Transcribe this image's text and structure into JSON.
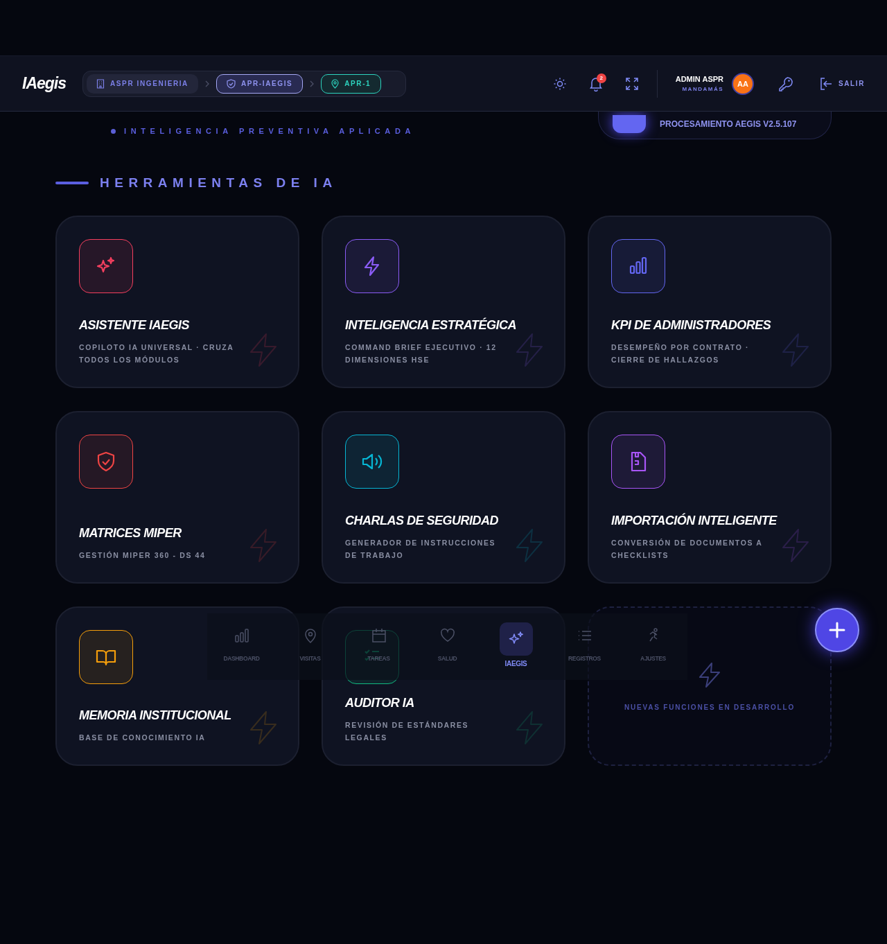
{
  "header": {
    "logo": "IAegis",
    "breadcrumbs": [
      {
        "kind": "company",
        "label": "ASPR INGENIERIA"
      },
      {
        "kind": "project",
        "label": "APR-IAEGIS"
      },
      {
        "kind": "site",
        "label": "APR-1"
      }
    ],
    "notifications": "2",
    "user": {
      "name": "ADMIN ASPR",
      "role": "MANDAMÁS",
      "initials": "AA"
    },
    "logout": "SALIR"
  },
  "status_pill": "PROCESAMIENTO AEGIS V2.5.107",
  "tagline": "INTELIGENCIA PREVENTIVA APLICADA",
  "section_title": "HERRAMIENTAS DE IA",
  "cards": [
    {
      "title": "ASISTENTE IAEGIS",
      "subtitle": "COPILOTO IA UNIVERSAL · CRUZA TODOS LOS MÓDULOS",
      "color": "#f43f5e"
    },
    {
      "title": "INTELIGENCIA ESTRATÉGICA",
      "subtitle": "COMMAND BRIEF EJECUTIVO · 12 DIMENSIONES HSE",
      "color": "#8b5cf6"
    },
    {
      "title": "KPI DE ADMINISTRADORES",
      "subtitle": "DESEMPEÑO POR CONTRATO · CIERRE DE HALLAZGOS",
      "color": "#6366f1"
    },
    {
      "title": "MATRICES MIPER",
      "subtitle": "GESTIÓN MIPER 360 - DS 44",
      "color": "#ef4444"
    },
    {
      "title": "CHARLAS DE SEGURIDAD",
      "subtitle": "GENERADOR DE INSTRUCCIONES DE TRABAJO",
      "color": "#06b6d4"
    },
    {
      "title": "IMPORTACIÓN INTELIGENTE",
      "subtitle": "CONVERSIÓN DE DOCUMENTOS A CHECKLISTS",
      "color": "#a855f7"
    },
    {
      "title": "MEMORIA INSTITUCIONAL",
      "subtitle": "BASE DE CONOCIMIENTO IA",
      "color": "#f59e0b"
    },
    {
      "title": "AUDITOR IA",
      "subtitle": "REVISIÓN DE ESTÁNDARES LEGALES",
      "color": "#10b981"
    }
  ],
  "placeholder_card": "NUEVAS FUNCIONES EN DESARROLLO",
  "bottom_nav": [
    {
      "label": "DASHBOARD",
      "selected": false
    },
    {
      "label": "VISITAS",
      "selected": false
    },
    {
      "label": "TAREAS",
      "selected": false
    },
    {
      "label": "SALUD",
      "selected": false
    },
    {
      "label": "IAEGIS",
      "selected": true
    },
    {
      "label": "REGISTROS",
      "selected": false
    },
    {
      "label": "AJUSTES",
      "selected": false
    }
  ]
}
